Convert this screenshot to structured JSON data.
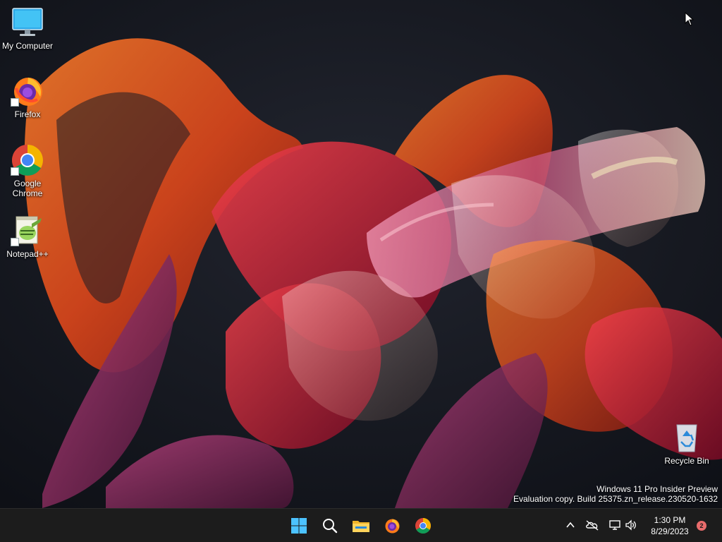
{
  "desktop": {
    "icons": [
      {
        "label": "My Computer"
      },
      {
        "label": "Firefox"
      },
      {
        "label": "Google Chrome"
      },
      {
        "label": "Notepad++"
      },
      {
        "label": "Recycle Bin"
      }
    ],
    "watermark": {
      "line1": "Windows 11 Pro Insider Preview",
      "line2": "Evaluation copy. Build 25375.zn_release.230520-1632"
    }
  },
  "taskbar": {
    "apps": [
      "windows-logo-icon",
      "search-icon",
      "file-explorer-icon",
      "firefox-icon",
      "chrome-icon"
    ],
    "tray": [
      "chevron-up-icon",
      "onedrive-icon",
      "network-icon",
      "volume-icon"
    ],
    "clock": {
      "time": "1:30 PM",
      "date": "8/29/2023"
    },
    "notifications": {
      "count": "2"
    }
  },
  "colors": {
    "taskbar_bg": "#1c1c1c",
    "wallpaper_bg": "#141620",
    "accent_orange": "#e8561e",
    "accent_red": "#c8102e",
    "accent_pink": "#d9588e",
    "badge": "#e86b6b"
  }
}
